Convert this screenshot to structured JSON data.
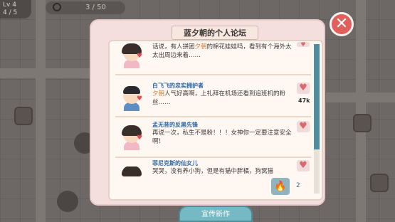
{
  "hud": {
    "left_label": "Lv 4",
    "left_value": "4 / 5",
    "progress_text": "3 / 50"
  },
  "dialog": {
    "title": "蓝夕朝的个人论坛",
    "close_symbol": "✕",
    "promote_button": "宣传新作",
    "fire_count": "2"
  },
  "posts": [
    {
      "author": "",
      "text_before": "话说，有人拼团",
      "highlight": "夕朝",
      "text_after": "的棉花娃娃吗，看到有个海外太太出周边来着……",
      "likes": "",
      "gender": "f"
    },
    {
      "author": "白飞飞的忠实拥护者",
      "text_before": "",
      "highlight": "夕朝",
      "text_after": "人气好高啊，上礼拜在机场还看到追班机的粉丝……",
      "likes": "47k",
      "gender": "m"
    },
    {
      "author": "孟无昔的反黑先锋",
      "text_before": "再说一次，私生不是粉！！！女神你一定要注意安全啊！",
      "highlight": "",
      "text_after": "",
      "likes": "",
      "gender": "f"
    },
    {
      "author": "菲尼克斯的仙女儿",
      "text_before": "哭哭，没有养小狗，但是有猫中胖橘，狗窝猫",
      "highlight": "",
      "text_after": "",
      "likes": "",
      "gender": "f"
    }
  ],
  "icons": {
    "like": "heart-icon",
    "fire": "fire-icon",
    "close": "close-icon"
  },
  "colors": {
    "accent": "#74b9c3",
    "close": "#e0605b",
    "name": "#2f68a8",
    "highlight": "#e07a3a"
  }
}
